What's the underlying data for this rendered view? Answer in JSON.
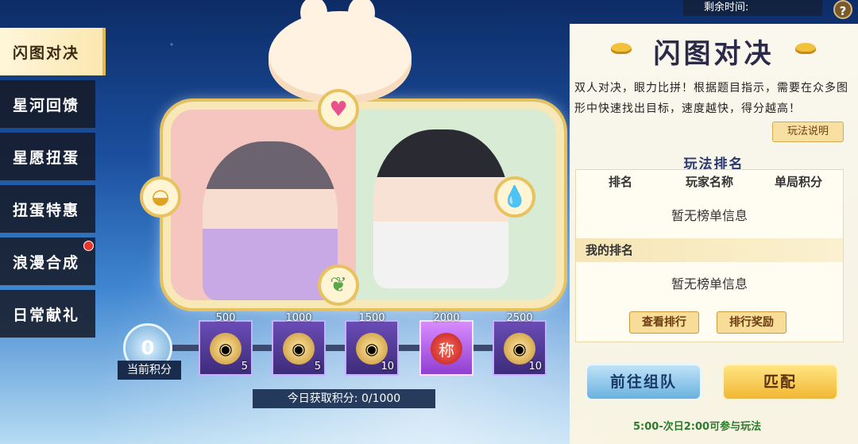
{
  "sidebar": {
    "items": [
      {
        "label": "闪图对决",
        "active": true
      },
      {
        "label": "星河回馈",
        "active": false
      },
      {
        "label": "星愿扭蛋",
        "active": false
      },
      {
        "label": "扭蛋特惠",
        "active": false
      },
      {
        "label": "浪漫合成",
        "active": false,
        "badge": true
      },
      {
        "label": "日常献礼",
        "active": false
      }
    ]
  },
  "timer": {
    "label": "剩余时间:"
  },
  "help": {
    "label": "?"
  },
  "panel": {
    "title": "闪图对决",
    "description": "双人对决，眼力比拼！根据题目指示，需要在众多图形中快速找出目标，速度越快，得分越高！",
    "rules_button": "玩法说明",
    "ranking_title": "玩法排名",
    "columns": [
      "排名",
      "玩家名称",
      "单局积分"
    ],
    "empty_text": "暂无榜单信息",
    "my_rank_label": "我的排名",
    "my_rank_empty": "暂无榜单信息",
    "view_rank_button": "查看排行",
    "rank_reward_button": "排行奖励",
    "team_button": "前往组队",
    "match_button": "匹配",
    "time_note": "5:00-次日2:00可参与玩法"
  },
  "score": {
    "value": "0",
    "label": "当前积分"
  },
  "rewards": [
    {
      "threshold": "500",
      "count": "5",
      "icon": "gift-bag-icon"
    },
    {
      "threshold": "1000",
      "count": "5",
      "icon": "gift-bag-icon"
    },
    {
      "threshold": "1500",
      "count": "10",
      "icon": "gift-bag-icon"
    },
    {
      "threshold": "2000",
      "count": "",
      "icon": "title-badge-icon",
      "glyph": "称"
    },
    {
      "threshold": "2500",
      "count": "10",
      "icon": "gift-bag-icon"
    }
  ],
  "today": {
    "label": "今日获取积分:",
    "value": "0/1000",
    "text": "今日获取积分: 0/1000"
  },
  "colors": {
    "accent_gold": "#e6c25e",
    "panel_bg": "#fdf8ea",
    "badge_red": "#e8342d"
  }
}
